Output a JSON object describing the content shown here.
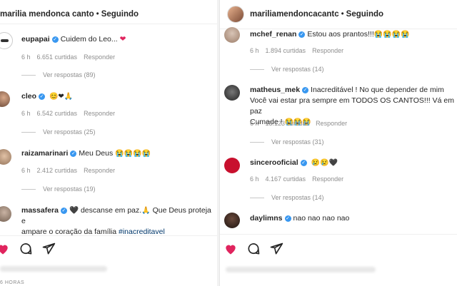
{
  "left": {
    "header": {
      "username": "marilia mendonca canto",
      "separator": "•",
      "follow": "Seguindo"
    },
    "comments": [
      {
        "user": "eupapai",
        "text": "Cuidem do Leo...",
        "emoji": "❤",
        "time": "6 h",
        "likes": "6.651 curtidas",
        "reply": "Responder",
        "view_replies": "Ver respostas (89)"
      },
      {
        "user": "cleo",
        "text": "",
        "emoji": "😊❤🙏",
        "time": "6 h",
        "likes": "6.542 curtidas",
        "reply": "Responder",
        "view_replies": "Ver respostas (25)"
      },
      {
        "user": "raizamarinari",
        "text": "Meu Deus",
        "emoji": "😭😭😭😭",
        "time": "6 h",
        "likes": "2.412 curtidas",
        "reply": "Responder",
        "view_replies": "Ver respostas (19)"
      },
      {
        "user": "massafera",
        "text_line1": "descanse em paz.",
        "text_line1b": "Que Deus proteja e",
        "text_line2": "ampare o coração da família",
        "hashtag": "#inacreditavel",
        "emoji1": "🖤",
        "emoji2": "🙏"
      }
    ],
    "footer": {
      "timestamp": "6 HORAS"
    }
  },
  "right": {
    "header": {
      "username": "mariliamendoncacantc",
      "separator": "•",
      "follow": "Seguindo"
    },
    "comments": [
      {
        "user": "mchef_renan",
        "text": "Estou aos prantos!!!",
        "emoji": "😭😭😭😭",
        "time": "6 h",
        "likes": "1.894 curtidas",
        "reply": "Responder",
        "view_replies": "Ver respostas (14)"
      },
      {
        "user": "matheus_mek",
        "line1": "Inacreditável ! No que depender de mim",
        "line2": "Você vai estar pra sempre em TODOS OS CANTOS!!! Vá em paz",
        "line3": "Cumade !",
        "emoji": "😭😭😭",
        "time": "6 h",
        "likes": "13.123 curtidas",
        "reply": "Responder",
        "view_replies": "Ver respostas (31)"
      },
      {
        "user": "sincerooficial",
        "text": "",
        "emoji": "😢😢🖤",
        "time": "6 h",
        "likes": "4.167 curtidas",
        "reply": "Responder",
        "view_replies": "Ver respostas (14)"
      },
      {
        "user": "daylimns",
        "text": "nao nao nao nao"
      }
    ]
  },
  "colors": {
    "verified": "#3897f0",
    "like": "#e0245e",
    "muted": "#8e8e8e"
  }
}
